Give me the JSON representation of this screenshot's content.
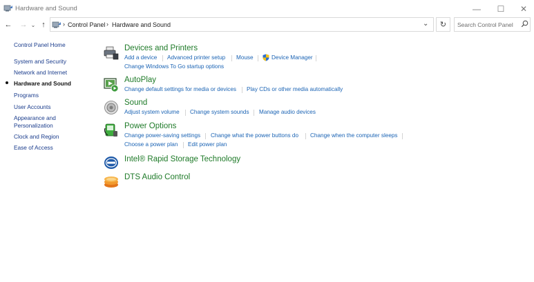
{
  "window": {
    "title": "Hardware and Sound",
    "minimize_glyph": "—",
    "maximize_glyph": "☐",
    "close_glyph": "✕"
  },
  "nav": {
    "back_glyph": "←",
    "forward_glyph": "→",
    "recent_glyph": "⌄",
    "up_glyph": "↑",
    "refresh_glyph": "↻",
    "dropdown_glyph": "⌄"
  },
  "address": {
    "breadcrumb": [
      "Control Panel",
      "Hardware and Sound"
    ],
    "separator": "›"
  },
  "search": {
    "placeholder": "Search Control Panel"
  },
  "sidebar": {
    "items": [
      {
        "label": "Control Panel Home"
      },
      {
        "label": "System and Security"
      },
      {
        "label": "Network and Internet"
      },
      {
        "label": "Hardware and Sound",
        "selected": true
      },
      {
        "label": "Programs"
      },
      {
        "label": "User Accounts"
      },
      {
        "label": "Appearance and Personalization"
      },
      {
        "label": "Clock and Region"
      },
      {
        "label": "Ease of Access"
      }
    ]
  },
  "categories": [
    {
      "title": "Devices and Printers",
      "icon": "printer-icon",
      "tasks": [
        "Add a device",
        "Advanced printer setup",
        "Mouse",
        "Device Manager",
        "Change Windows To Go startup options"
      ]
    },
    {
      "title": "AutoPlay",
      "icon": "autoplay-icon",
      "tasks": [
        "Change default settings for media or devices",
        "Play CDs or other media automatically"
      ]
    },
    {
      "title": "Sound",
      "icon": "speaker-icon",
      "tasks": [
        "Adjust system volume",
        "Change system sounds",
        "Manage audio devices"
      ]
    },
    {
      "title": "Power Options",
      "icon": "power-options-icon",
      "tasks": [
        "Change power-saving settings",
        "Change what the power buttons do",
        "Change when the computer sleeps",
        "Choose a power plan",
        "Edit power plan"
      ]
    },
    {
      "title": "Intel® Rapid Storage Technology",
      "icon": "intel-rst-icon",
      "tasks": []
    },
    {
      "title": "DTS Audio Control",
      "icon": "dts-audio-icon",
      "tasks": []
    }
  ],
  "colors": {
    "category_title": "#1e7a28",
    "task_link": "#1a63b4",
    "sidebar_link": "#1a3c8c"
  }
}
